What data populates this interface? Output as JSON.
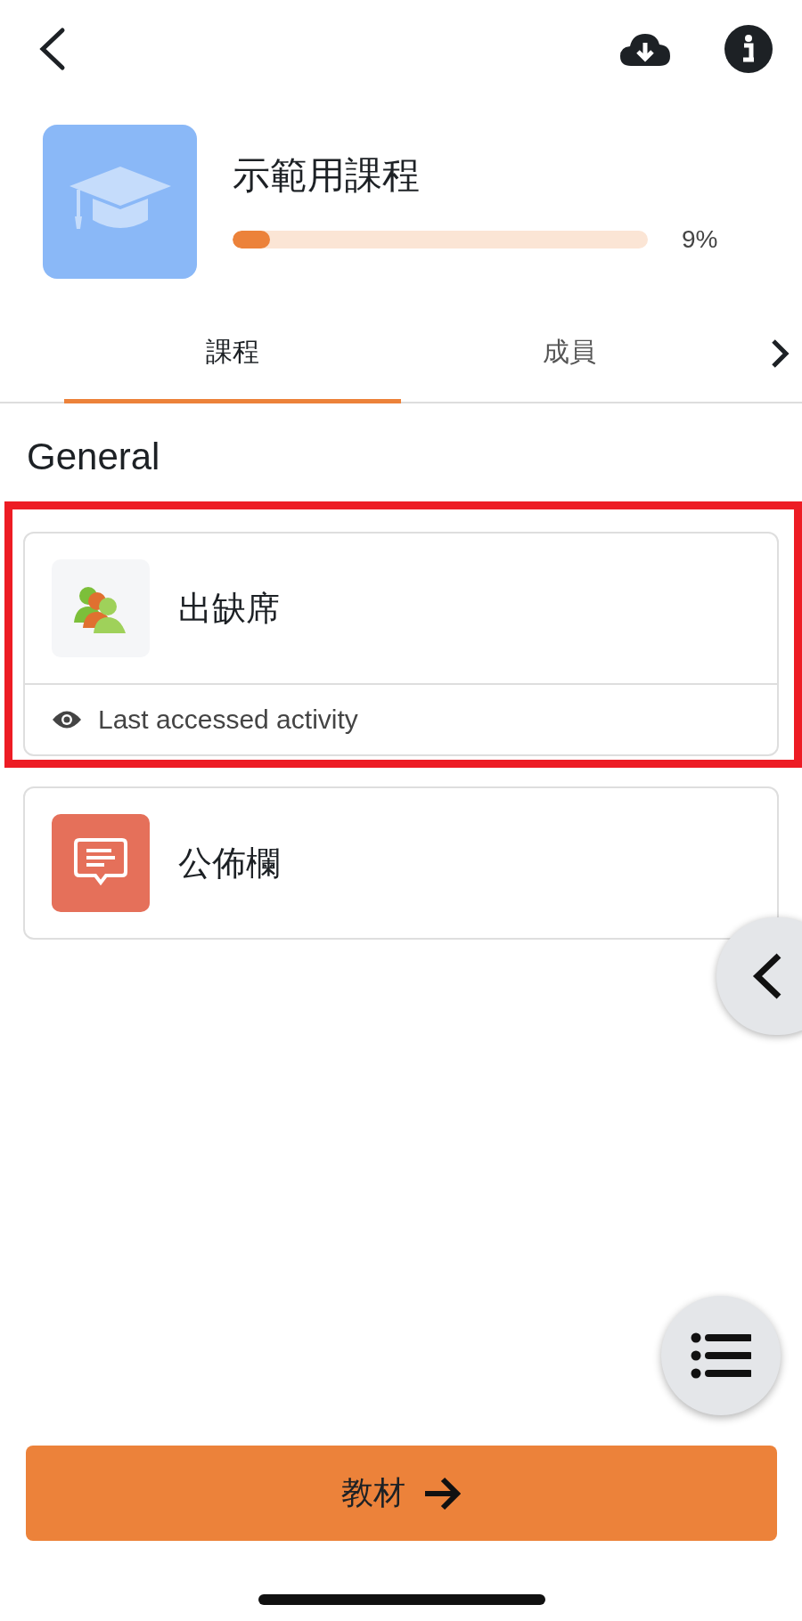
{
  "course": {
    "title": "示範用課程",
    "level": 0.09,
    "percent": "9%"
  },
  "tabs": [
    {
      "label": "課程",
      "selected": true
    },
    {
      "label": "成員",
      "selected": false
    }
  ],
  "section": {
    "title": "General"
  },
  "activities": [
    {
      "kind": "attendance",
      "name": "出缺席",
      "highlighted": true,
      "note": "Last accessed activity"
    },
    {
      "kind": "forum",
      "name": "公佈欄",
      "highlighted": false
    }
  ],
  "next_button": {
    "label": "教材"
  }
}
